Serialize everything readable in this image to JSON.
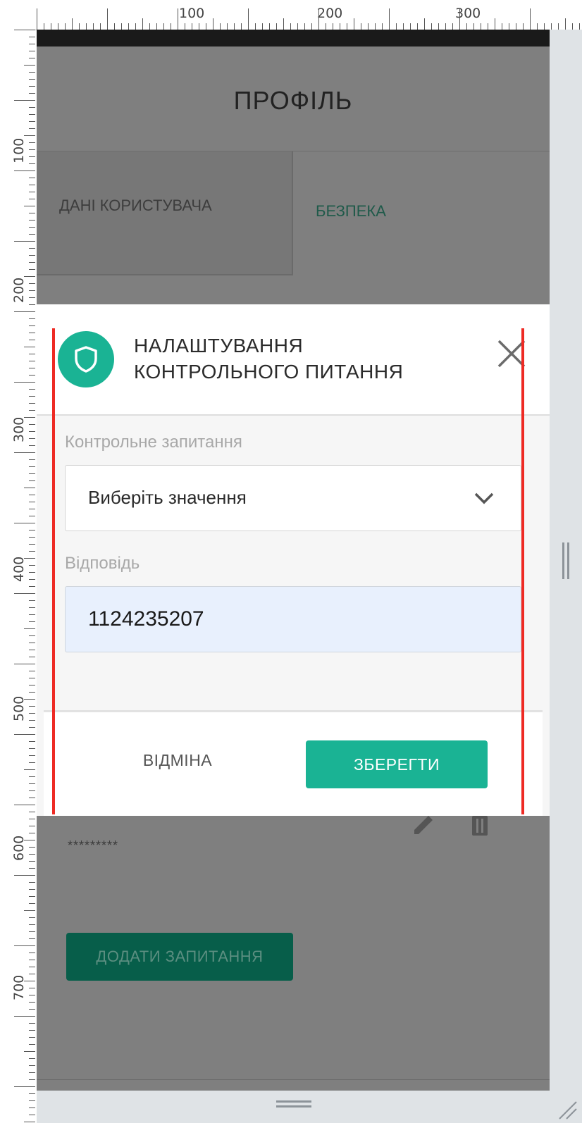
{
  "ruler": {
    "top_labels": [
      "100",
      "200",
      "300"
    ],
    "left_labels": [
      "100",
      "200",
      "300",
      "400",
      "500",
      "600",
      "700"
    ]
  },
  "page": {
    "title": "ПРОФІЛЬ"
  },
  "tabs": [
    {
      "label": "ДАНІ КОРИСТУВАЧА",
      "active": false
    },
    {
      "label": "БЕЗПЕКА",
      "active": true
    }
  ],
  "security_list": {
    "masked_answer": "*********",
    "add_button_label": "ДОДАТИ ЗАПИТАННЯ"
  },
  "modal": {
    "title_line1": "НАЛАШТУВАННЯ",
    "title_line2": "КОНТРОЛЬНОГО ПИТАННЯ",
    "icon": "shield-icon",
    "question_label": "Контрольне запитання",
    "question_value": "Виберіть значення",
    "answer_label": "Відповідь",
    "answer_value": "1124235207",
    "cancel_label": "ВІДМІНА",
    "save_label": "ЗБЕРЕГТИ"
  },
  "colors": {
    "accent": "#1ab394",
    "dark_accent": "#075e4a",
    "overlay": "#7f7f7f",
    "guide": "#ee2a24"
  }
}
